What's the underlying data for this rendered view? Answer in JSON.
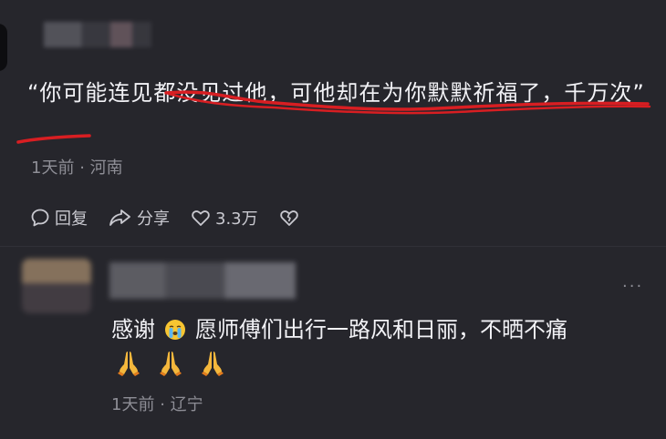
{
  "comment": {
    "text": "“你可能连见都没见过他，可他却在为你默默祈福了，千万次”",
    "time": "1天前",
    "separator": "·",
    "location": "河南",
    "actions": {
      "reply_label": "回复",
      "share_label": "分享",
      "like_count": "3.3万"
    }
  },
  "reply": {
    "text_before": "感谢",
    "text_after": "愿师傅们出行一路风和日丽，不晒不痛",
    "emoji": [
      "pray-emoji",
      "pray-emoji",
      "pray-emoji"
    ],
    "time": "1天前",
    "separator": "·",
    "location": "辽宁",
    "more": "···"
  },
  "colors": {
    "background": "#26262c",
    "text_primary": "#f2f2f6",
    "text_meta": "#8e8e96",
    "annotation_red": "#d81e22",
    "emoji_yellow": "#f7c531"
  }
}
